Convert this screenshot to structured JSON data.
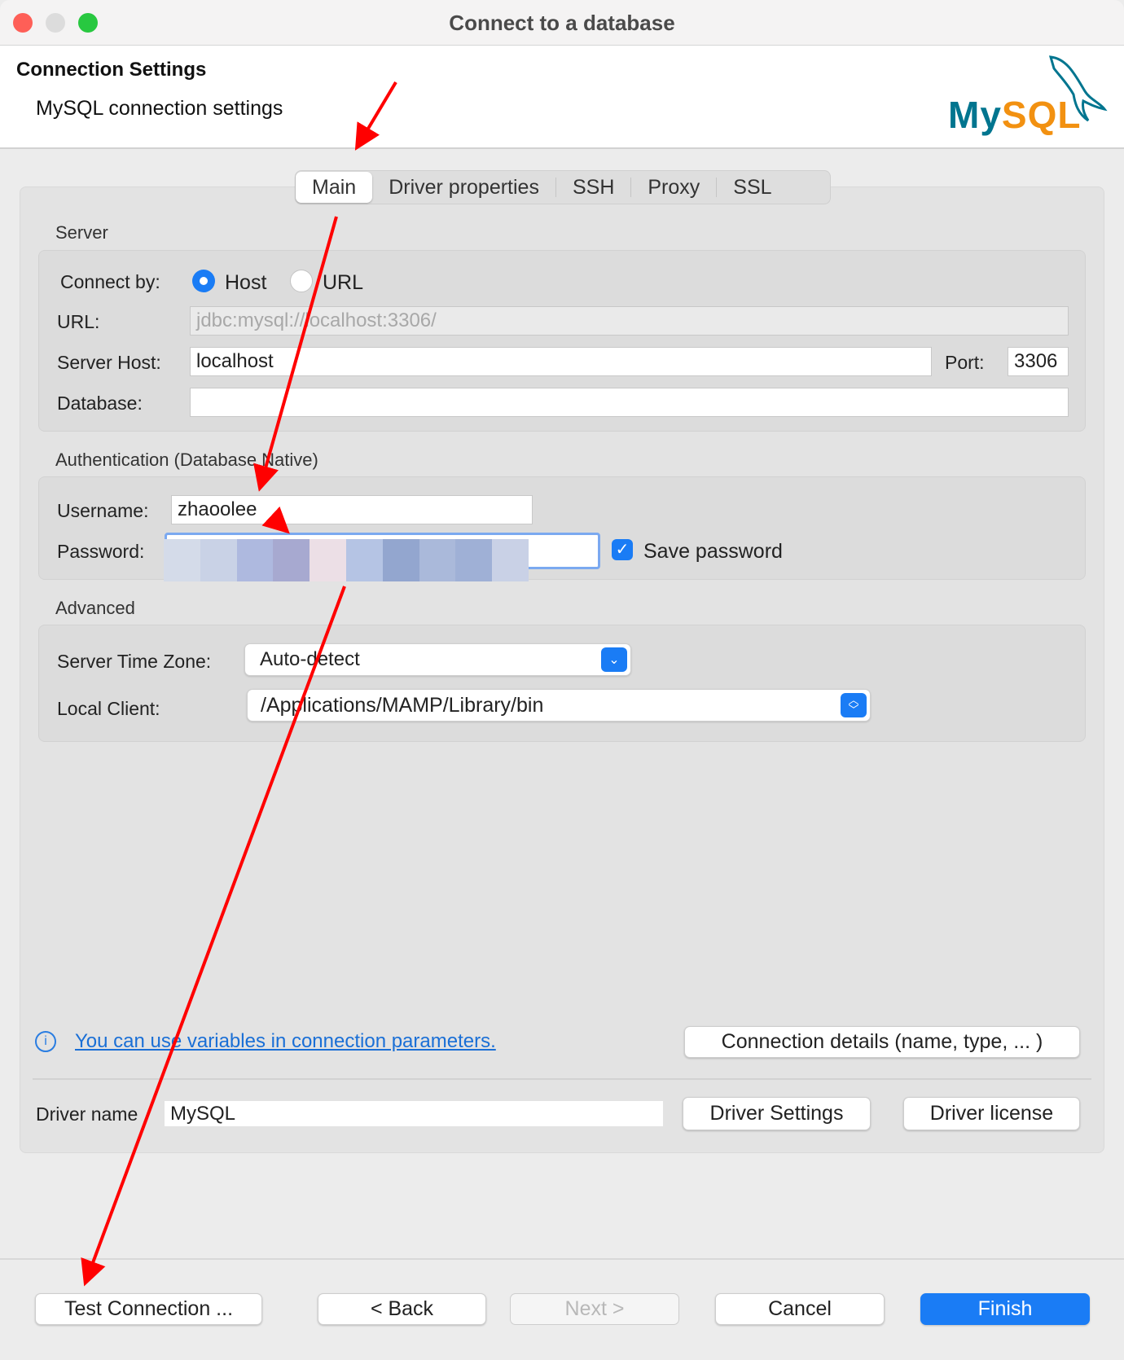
{
  "window": {
    "title": "Connect to a database"
  },
  "header": {
    "title": "Connection Settings",
    "subtitle": "MySQL connection settings",
    "logo_text": "MySQL"
  },
  "tabs": [
    {
      "label": "Main",
      "active": true
    },
    {
      "label": "Driver properties"
    },
    {
      "label": "SSH"
    },
    {
      "label": "Proxy"
    },
    {
      "label": "SSL"
    }
  ],
  "server": {
    "section": "Server",
    "connect_by_label": "Connect by:",
    "options": [
      {
        "label": "Host",
        "selected": true
      },
      {
        "label": "URL",
        "selected": false
      }
    ],
    "url_label": "URL:",
    "url_value": "jdbc:mysql://localhost:3306/",
    "host_label": "Server Host:",
    "host_value": "localhost",
    "port_label": "Port:",
    "port_value": "3306",
    "database_label": "Database:",
    "database_value": ""
  },
  "auth": {
    "section": "Authentication (Database Native)",
    "username_label": "Username:",
    "username_value": "zhaoolee",
    "password_label": "Password:",
    "save_password_label": "Save password",
    "save_password_checked": true
  },
  "advanced": {
    "section": "Advanced",
    "timezone_label": "Server Time Zone:",
    "timezone_value": "Auto-detect",
    "local_client_label": "Local Client:",
    "local_client_value": "/Applications/MAMP/Library/bin"
  },
  "info": {
    "link": "You can use variables in connection parameters.",
    "details_button": "Connection details (name, type, ... )"
  },
  "driver": {
    "label": "Driver name",
    "value": "MySQL",
    "settings_button": "Driver Settings",
    "license_button": "Driver license"
  },
  "footer": {
    "test": "Test Connection ...",
    "back": "< Back",
    "next": "Next >",
    "cancel": "Cancel",
    "finish": "Finish"
  },
  "colors": {
    "accent": "#1a7cf5",
    "annotation": "#ff0000",
    "mysql_teal": "#00758f",
    "mysql_orange": "#f29111"
  }
}
